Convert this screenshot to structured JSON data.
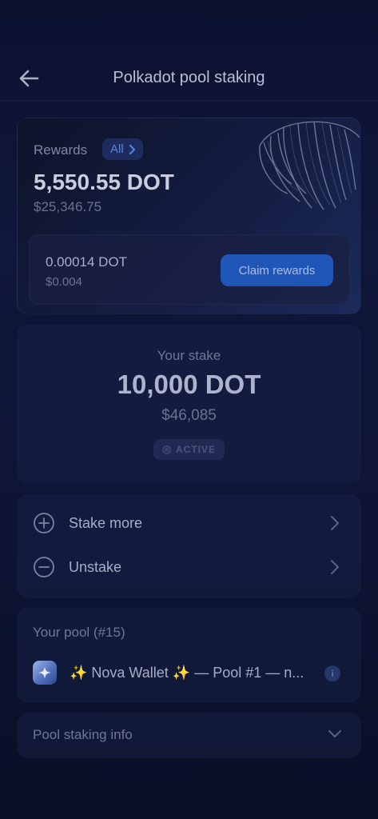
{
  "header": {
    "title": "Polkadot pool staking",
    "back_icon": "arrow-left-icon"
  },
  "rewards": {
    "label": "Rewards",
    "filter_label": "All",
    "amount": "5,550.55 DOT",
    "fiat": "$25,346.75",
    "claimable_amount": "0.00014 DOT",
    "claimable_fiat": "$0.004",
    "claim_button": "Claim rewards"
  },
  "stake": {
    "label": "Your stake",
    "amount": "10,000 DOT",
    "fiat": "$46,085",
    "status": "ACTIVE"
  },
  "actions": [
    {
      "label": "Stake more",
      "icon": "plus-circle-icon"
    },
    {
      "label": "Unstake",
      "icon": "minus-circle-icon"
    }
  ],
  "pool": {
    "label": "Your pool (#15)",
    "name": "✨ Nova Wallet ✨ — Pool #1 — n...",
    "info_icon": "i"
  },
  "info_section": {
    "label": "Pool staking info"
  },
  "colors": {
    "accent": "#1f56b8",
    "link": "#4f86e8",
    "background": "#0d1433"
  }
}
